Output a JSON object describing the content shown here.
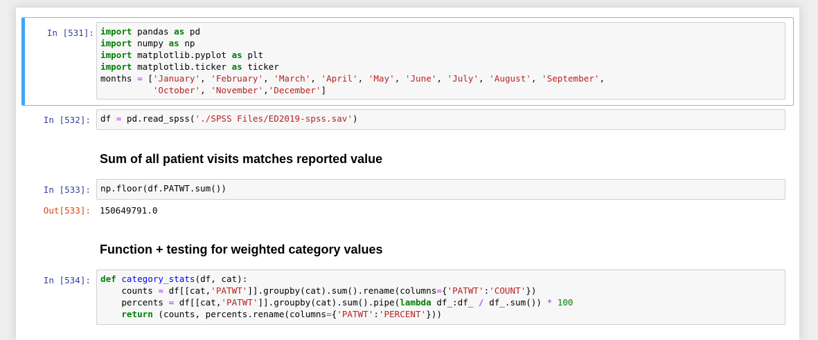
{
  "cells": {
    "c531": {
      "prompt": "In [531]:",
      "lines": [
        [
          "import",
          " pandas ",
          "as",
          " pd"
        ],
        [
          "import",
          " numpy ",
          "as",
          " np"
        ],
        [
          "import",
          " matplotlib.pyplot ",
          "as",
          " plt"
        ],
        [
          "import",
          " matplotlib.ticker ",
          "as",
          " ticker"
        ]
      ],
      "months_line": {
        "name": "months ",
        "eq": "=",
        "open": " [",
        "row1": [
          "'January'",
          "'February'",
          "'March'",
          "'April'",
          "'May'",
          "'June'",
          "'July'",
          "'August'",
          "'September'"
        ],
        "row2": [
          "'October'",
          "'November'",
          "'December'"
        ],
        "close": "]"
      }
    },
    "c532": {
      "prompt": "In [532]:",
      "a": "df ",
      "eq": "=",
      "b": " pd.read_spss(",
      "str": "'./SPSS Files/ED2019-spss.sav'",
      "c": ")"
    },
    "heading1": "Sum of all patient visits matches reported value",
    "c533": {
      "prompt": "In [533]:",
      "code": "np.floor(df.PATWT.sum())",
      "out_prompt": "Out[533]:",
      "output": "150649791.0"
    },
    "heading2": "Function + testing for weighted category values",
    "c534": {
      "prompt": "In [534]:",
      "def_kw": "def",
      "fn_name": "category_stats",
      "sig": "(df, cat):",
      "l2a": "    counts ",
      "l2b": " df[[cat,",
      "l2s1": "'PATWT'",
      "l2c": "]].groupby(cat).sum().rename(columns",
      "l2d": "{",
      "l2s2": "'PATWT'",
      "l2e": ":",
      "l2s3": "'COUNT'",
      "l2f": "})",
      "l3a": "    percents ",
      "l3b": " df[[cat,",
      "l3s1": "'PATWT'",
      "l3c": "]].groupby(cat).sum().pipe(",
      "l3kw": "lambda",
      "l3d": " df_:df_ ",
      "l3div": "/",
      "l3e": " df_.sum()) ",
      "l3mul": "*",
      "l3num": "100",
      "l4kw": "return",
      "l4a": " (counts, percents.rename(columns",
      "l4b": "{",
      "l4s1": "'PATWT'",
      "l4c": ":",
      "l4s2": "'PERCENT'",
      "l4d": "}))"
    }
  }
}
